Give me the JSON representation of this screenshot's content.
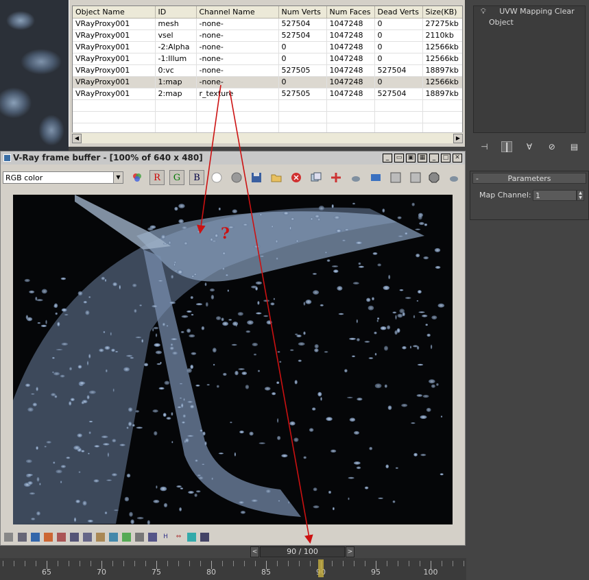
{
  "table": {
    "columns": [
      "Object Name",
      "ID",
      "Channel Name",
      "Num Verts",
      "Num Faces",
      "Dead Verts",
      "Size(KB)"
    ],
    "rows": [
      [
        "VRayProxy001",
        "mesh",
        "-none-",
        "527504",
        "1047248",
        "0",
        "27275kb"
      ],
      [
        "VRayProxy001",
        "vsel",
        "-none-",
        "527504",
        "1047248",
        "0",
        "2110kb"
      ],
      [
        "VRayProxy001",
        "-2:Alpha",
        "-none-",
        "0",
        "1047248",
        "0",
        "12566kb"
      ],
      [
        "VRayProxy001",
        "-1:Illum",
        "-none-",
        "0",
        "1047248",
        "0",
        "12566kb"
      ],
      [
        "VRayProxy001",
        "0:vc",
        "-none-",
        "527505",
        "1047248",
        "527504",
        "18897kb"
      ],
      [
        "VRayProxy001",
        "1:map",
        "-none-",
        "0",
        "1047248",
        "0",
        "12566kb"
      ],
      [
        "VRayProxy001",
        "2:map",
        "r_texture",
        "527505",
        "1047248",
        "527504",
        "18897kb"
      ]
    ],
    "selected_row": 5
  },
  "vray": {
    "title": "V-Ray frame buffer - [100% of 640 x 480]",
    "channel_value": "RGB color",
    "btn_r": "R",
    "btn_g": "G",
    "btn_b": "B"
  },
  "modifier_stack": {
    "items": [
      "UVW Mapping Clear",
      "Object"
    ]
  },
  "parameters": {
    "header": "Parameters",
    "map_channel_label": "Map Channel:",
    "map_channel_value": "1"
  },
  "timeline": {
    "slider_text": "90 / 100",
    "prev": "<",
    "next": ">",
    "ticks": [
      "65",
      "70",
      "75",
      "80",
      "85",
      "90",
      "95",
      "100"
    ],
    "current_frame": 90
  },
  "annotation": {
    "question_mark": "?",
    "arrow_color": "#cc1111"
  }
}
